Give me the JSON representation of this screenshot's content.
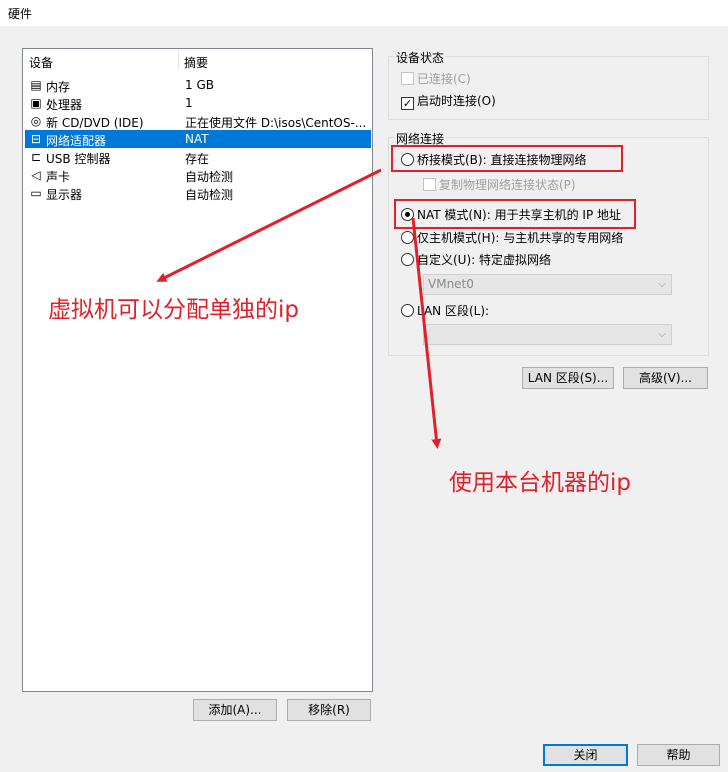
{
  "window": {
    "title": "硬件"
  },
  "device_list": {
    "columns": [
      "设备",
      "摘要"
    ],
    "rows": [
      {
        "name": "内存",
        "summary": "1 GB",
        "icon": "memory-icon",
        "glyph": "▤"
      },
      {
        "name": "处理器",
        "summary": "1",
        "icon": "cpu-icon",
        "glyph": "▣"
      },
      {
        "name": "新 CD/DVD (IDE)",
        "summary": "正在使用文件 D:\\isos\\CentOS-...",
        "icon": "cd-icon",
        "glyph": "◎"
      },
      {
        "name": "网络适配器",
        "summary": "NAT",
        "icon": "network-adapter-icon",
        "glyph": "⊟",
        "selected": true
      },
      {
        "name": "USB 控制器",
        "summary": "存在",
        "icon": "usb-icon",
        "glyph": "⊏"
      },
      {
        "name": "声卡",
        "summary": "自动检测",
        "icon": "speaker-icon",
        "glyph": "◁"
      },
      {
        "name": "显示器",
        "summary": "自动检测",
        "icon": "monitor-icon",
        "glyph": "▭"
      }
    ]
  },
  "buttons": {
    "add": "添加(A)...",
    "remove": "移除(R)",
    "lan_segments": "LAN 区段(S)...",
    "advanced": "高级(V)...",
    "close": "关闭",
    "help": "帮助"
  },
  "device_status": {
    "title": "设备状态",
    "connected": "已连接(C)",
    "connect_on_power_on": "启动时连接(O)"
  },
  "network_connection": {
    "title": "网络连接",
    "bridged": "桥接模式(B): 直接连接物理网络",
    "replicate": "复制物理网络连接状态(P)",
    "nat": "NAT 模式(N): 用于共享主机的 IP 地址",
    "host_only": "仅主机模式(H): 与主机共享的专用网络",
    "custom": "自定义(U): 特定虚拟网络",
    "custom_value": "VMnet0",
    "lan_segment": "LAN 区段(L):",
    "lan_segment_value": ""
  },
  "annotations": {
    "left": "虚拟机可以分配单独的ip",
    "right": "使用本台机器的ip",
    "color": "#e0202a"
  }
}
